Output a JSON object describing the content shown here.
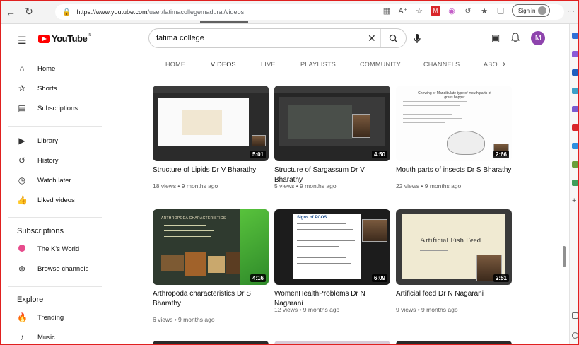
{
  "browser": {
    "url_prefix": "https://www.youtube.com",
    "url_path": "/user/fatimacollegemadurai/videos",
    "signin_label": "Sign in",
    "red_icon_text": "M"
  },
  "header": {
    "logo_word": "YouTube",
    "logo_suffix": "IN",
    "search_value": "fatima college",
    "avatar_letter": "M"
  },
  "sidebar": {
    "main": [
      {
        "label": "Home",
        "icon": "home-icon"
      },
      {
        "label": "Shorts",
        "icon": "shorts-icon"
      },
      {
        "label": "Subscriptions",
        "icon": "subscriptions-icon"
      }
    ],
    "library": [
      {
        "label": "Library",
        "icon": "library-icon"
      },
      {
        "label": "History",
        "icon": "history-icon"
      },
      {
        "label": "Watch later",
        "icon": "clock-icon"
      },
      {
        "label": "Liked videos",
        "icon": "thumbs-up-icon"
      }
    ],
    "subscriptions_heading": "Subscriptions",
    "subscriptions": [
      {
        "label": "The K's World",
        "icon": "channel-avatar"
      },
      {
        "label": "Browse channels",
        "icon": "plus-circle-icon"
      }
    ],
    "explore_heading": "Explore",
    "explore": [
      {
        "label": "Trending",
        "icon": "flame-icon"
      },
      {
        "label": "Music",
        "icon": "music-note-icon"
      }
    ]
  },
  "tabs": [
    "HOME",
    "VIDEOS",
    "LIVE",
    "PLAYLISTS",
    "COMMUNITY",
    "CHANNELS",
    "ABO"
  ],
  "active_tab": "VIDEOS",
  "videos": [
    {
      "title": "Structure of Lipids Dr V Bharathy",
      "meta": "18 views • 9 months ago",
      "duration": "5:01"
    },
    {
      "title": "Structure of Sargassum Dr V Bharathy",
      "meta": "5 views • 9 months ago",
      "duration": "4:50"
    },
    {
      "title": "Mouth parts of insects Dr S Bharathy",
      "meta": "22 views • 9 months ago",
      "duration": "2:66"
    },
    {
      "title": "Arthropoda characteristics Dr S Bharathy",
      "meta": "6 views • 9 months ago",
      "duration": "4:16"
    },
    {
      "title": "WomenHealthProblems Dr N Nagarani",
      "meta": "12 views • 9 months ago",
      "duration": "6:09"
    },
    {
      "title": "Artificial feed Dr N Nagarani",
      "meta": "9 views • 9 months ago",
      "duration": "2:51"
    }
  ],
  "thumb_text": {
    "mouth_parts": "Chewing or Mandibulate type of mouth parts of grass hopper",
    "arthropoda": "ARTHROPODA CHARACTERISTICS",
    "pcos": "Signs of PCOS",
    "fish_feed": "Artificial Fish Feed"
  }
}
